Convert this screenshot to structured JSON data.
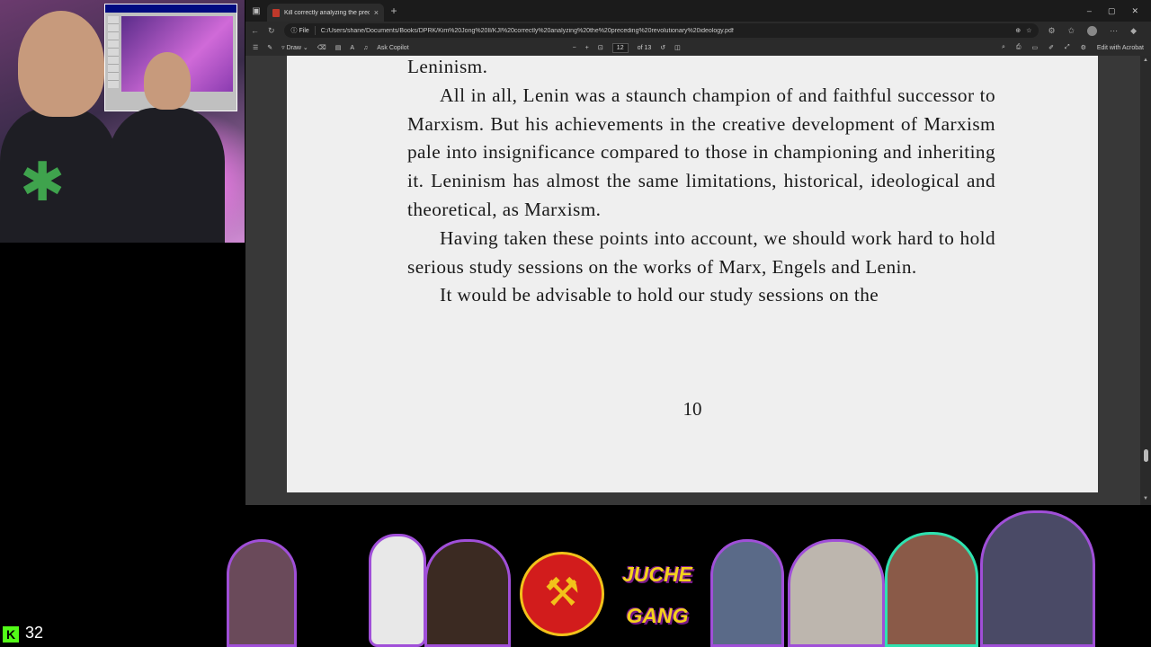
{
  "browser": {
    "tab_title": "Kill correctly analyzing the prece...",
    "tab_close": "×",
    "new_tab": "+",
    "window_controls": [
      "–",
      "▢",
      "✕"
    ],
    "file_chip": "File",
    "url": "C:/Users/shane/Documents/Books/DPRK/Kim%20Jong%20Il/KJI%20correctly%20analyzing%20the%20preceding%20revolutionary%20ideology.pdf"
  },
  "pdf_toolbar": {
    "draw_label": "Draw",
    "ask_copilot": "Ask Copilot",
    "zoom_out": "−",
    "zoom_in": "+",
    "page_current": "12",
    "page_total": "of 13",
    "edit_acrobat": "Edit with Acrobat"
  },
  "document": {
    "para0": "Leninism.",
    "para1": "All in all, Lenin was a staunch champion of and faithful successor to Marxism. But his achievements in the creative development of Marxism pale into insignificance compared to those in championing and inheriting it. Leninism has almost the same limitations, historical, ideological and theoretical, as Marxism.",
    "para2": "Having taken these points into account, we should work hard to hold serious study sessions on the works of Marx, Engels and Lenin.",
    "para3": "It would be advisable to hold our study sessions on the",
    "page_number": "10"
  },
  "overlay": {
    "viewer_count": "32",
    "juche_line1": "JUCHE",
    "juche_line2": "GANG"
  },
  "colors": {
    "page_bg": "#efefef",
    "viewer_bg": "#383838",
    "kick_green": "#53fc18",
    "sticker_outline": "#a04fd8"
  },
  "icons": [
    "sidebar-toggle-icon",
    "highlight-icon",
    "draw-icon",
    "eraser-icon",
    "page-view-icon",
    "read-aloud-icon",
    "fit-page-icon",
    "rotate-icon",
    "two-page-icon",
    "search-icon",
    "print-icon",
    "save-icon",
    "save-as-icon",
    "fullscreen-icon",
    "settings-icon",
    "favorite-icon",
    "extensions-icon"
  ]
}
